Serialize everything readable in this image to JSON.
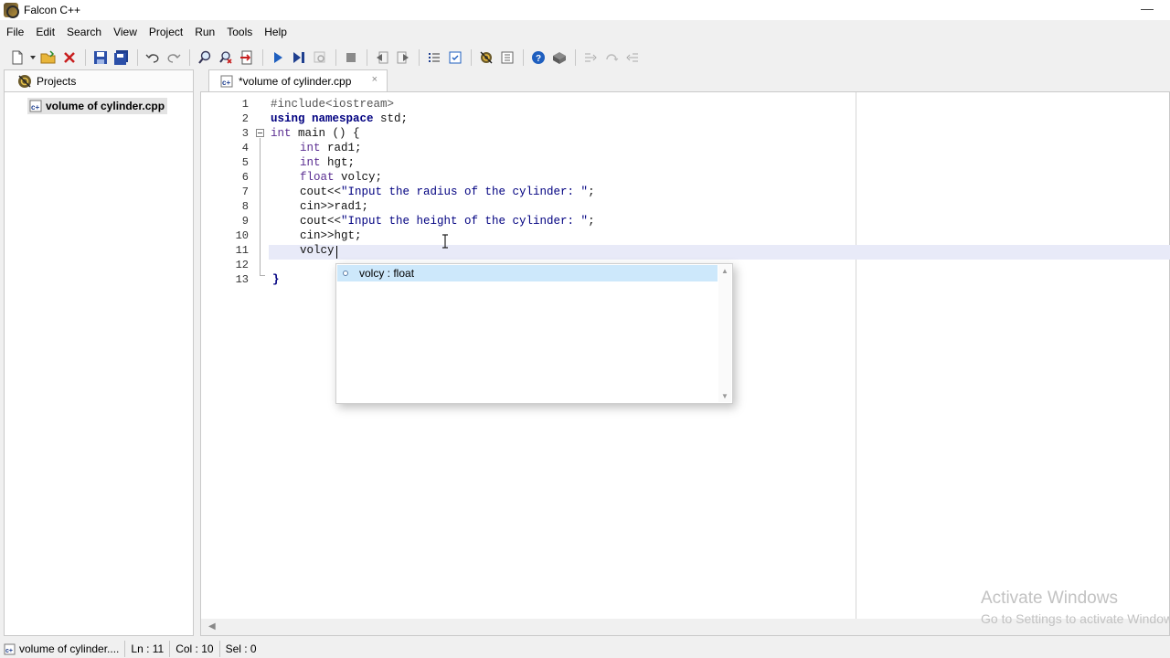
{
  "window": {
    "title": "Falcon C++",
    "minimize_glyph": "—"
  },
  "menu": [
    "File",
    "Edit",
    "Search",
    "View",
    "Project",
    "Run",
    "Tools",
    "Help"
  ],
  "toolbar_icons": [
    "new-file-icon",
    "open-folder-icon",
    "close-file-icon",
    "save-icon",
    "save-all-icon",
    "undo-icon",
    "redo-icon",
    "find-icon",
    "replace-icon",
    "goto-icon",
    "run-icon",
    "run-to-end-icon",
    "debug-icon",
    "stop-icon",
    "step-back-icon",
    "step-forward-icon",
    "bullet-list-icon",
    "check-doc-icon",
    "build-icon",
    "properties-icon",
    "help-icon",
    "package-icon",
    "indent-icon",
    "redo-arrow-icon",
    "outdent-icon"
  ],
  "projects_panel": {
    "tab_label": "Projects",
    "items": [
      {
        "label": "volume of cylinder.cpp"
      }
    ]
  },
  "editor": {
    "tab_label": "*volume of cylinder.cpp",
    "tab_close": "×",
    "line_numbers": [
      "1",
      "2",
      "3",
      "4",
      "5",
      "6",
      "7",
      "8",
      "9",
      "10",
      "11",
      "12",
      "13"
    ],
    "lines": {
      "l1": "#include<iostream>",
      "l2_kw": "using namespace",
      "l2_rest": " std;",
      "l3_ty": "int",
      "l3_rest": " main () {",
      "l4_ty": "int",
      "l4_rest": " rad1;",
      "l5_ty": "int",
      "l5_rest": " hgt;",
      "l6_ty": "float",
      "l6_rest": " volcy;",
      "l7_a": "cout<<",
      "l7_str": "\"Input the radius of the cylinder: \"",
      "l7_b": ";",
      "l8": "cin>>rad1;",
      "l9_a": "cout<<",
      "l9_str": "\"Input the height of the cylinder: \"",
      "l9_b": ";",
      "l10": "cin>>hgt;",
      "l11": "volcy",
      "l13": "}"
    }
  },
  "autocomplete": {
    "items": [
      {
        "label": "volcy : float"
      }
    ]
  },
  "statusbar": {
    "file": "volume of cylinder....",
    "line": "Ln : 11",
    "col": "Col : 10",
    "sel": "Sel : 0"
  },
  "watermark": {
    "title": "Activate Windows",
    "subtitle": "Go to Settings to activate Windows."
  },
  "colors": {
    "keyword": "#000080",
    "type": "#5a2d91",
    "selection": "#cde8fb",
    "current_line": "#e8eaf8"
  }
}
